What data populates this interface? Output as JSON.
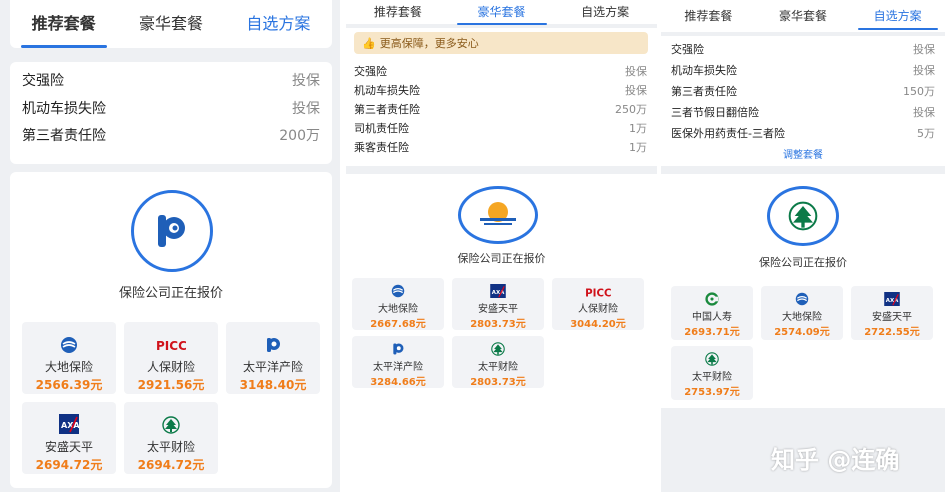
{
  "screens": [
    {
      "tabs": [
        {
          "label": "推荐套餐",
          "state": "active"
        },
        {
          "label": "豪华套餐",
          "state": "normal"
        },
        {
          "label": "自选方案",
          "state": "blue"
        }
      ],
      "coverage": [
        {
          "name": "交强险",
          "value": "投保"
        },
        {
          "name": "机动车损失险",
          "value": "投保"
        },
        {
          "name": "第三者责任险",
          "value": "200万"
        }
      ],
      "quoting_text": "保险公司正在报价",
      "insurers": [
        {
          "name": "大地保险",
          "price": "2566.39元",
          "icon": "ccic-logo-icon"
        },
        {
          "name": "人保财险",
          "price": "2921.56元",
          "icon": "picc-logo-icon"
        },
        {
          "name": "太平洋产险",
          "price": "3148.40元",
          "icon": "cpic-logo-icon"
        },
        {
          "name": "安盛天平",
          "price": "2694.72元",
          "icon": "axa-logo-icon"
        },
        {
          "name": "太平财险",
          "price": "2694.72元",
          "icon": "taiping-logo-icon"
        }
      ]
    },
    {
      "tabs": [
        {
          "label": "推荐套餐",
          "state": "normal"
        },
        {
          "label": "豪华套餐",
          "state": "active-blue"
        },
        {
          "label": "自选方案",
          "state": "normal"
        }
      ],
      "banner": "更高保障，更多安心",
      "coverage": [
        {
          "name": "交强险",
          "value": "投保"
        },
        {
          "name": "机动车损失险",
          "value": "投保"
        },
        {
          "name": "第三者责任险",
          "value": "250万"
        },
        {
          "name": "司机责任险",
          "value": "1万"
        },
        {
          "name": "乘客责任险",
          "value": "1万"
        }
      ],
      "quoting_text": "保险公司正在报价",
      "insurers": [
        {
          "name": "大地保险",
          "price": "2667.68元",
          "icon": "ccic-logo-icon"
        },
        {
          "name": "安盛天平",
          "price": "2803.73元",
          "icon": "axa-logo-icon"
        },
        {
          "name": "人保财险",
          "price": "3044.20元",
          "icon": "picc-logo-icon"
        },
        {
          "name": "太平洋产险",
          "price": "3284.66元",
          "icon": "cpic-logo-icon"
        },
        {
          "name": "太平财险",
          "price": "2803.73元",
          "icon": "taiping-logo-icon"
        }
      ]
    },
    {
      "tabs": [
        {
          "label": "推荐套餐",
          "state": "normal"
        },
        {
          "label": "豪华套餐",
          "state": "normal"
        },
        {
          "label": "自选方案",
          "state": "active-blue"
        }
      ],
      "coverage": [
        {
          "name": "交强险",
          "value": "投保"
        },
        {
          "name": "机动车损失险",
          "value": "投保"
        },
        {
          "name": "第三者责任险",
          "value": "150万"
        },
        {
          "name": "三者节假日翻倍险",
          "value": "投保"
        },
        {
          "name": "医保外用药责任-三者险",
          "value": "5万"
        }
      ],
      "adjust_label": "调整套餐",
      "quoting_text": "保险公司正在报价",
      "insurers": [
        {
          "name": "中国人寿",
          "price": "2693.71元",
          "icon": "chinalife-logo-icon"
        },
        {
          "name": "大地保险",
          "price": "2574.09元",
          "icon": "ccic-logo-icon"
        },
        {
          "name": "安盛天平",
          "price": "2722.55元",
          "icon": "axa-logo-icon"
        },
        {
          "name": "太平财险",
          "price": "2753.97元",
          "icon": "taiping-logo-icon"
        }
      ]
    }
  ],
  "watermark": "知乎 @连确",
  "colors": {
    "accent": "#2a74e0",
    "price": "#f07d1a",
    "banner_bg": "#f7e6c8"
  }
}
